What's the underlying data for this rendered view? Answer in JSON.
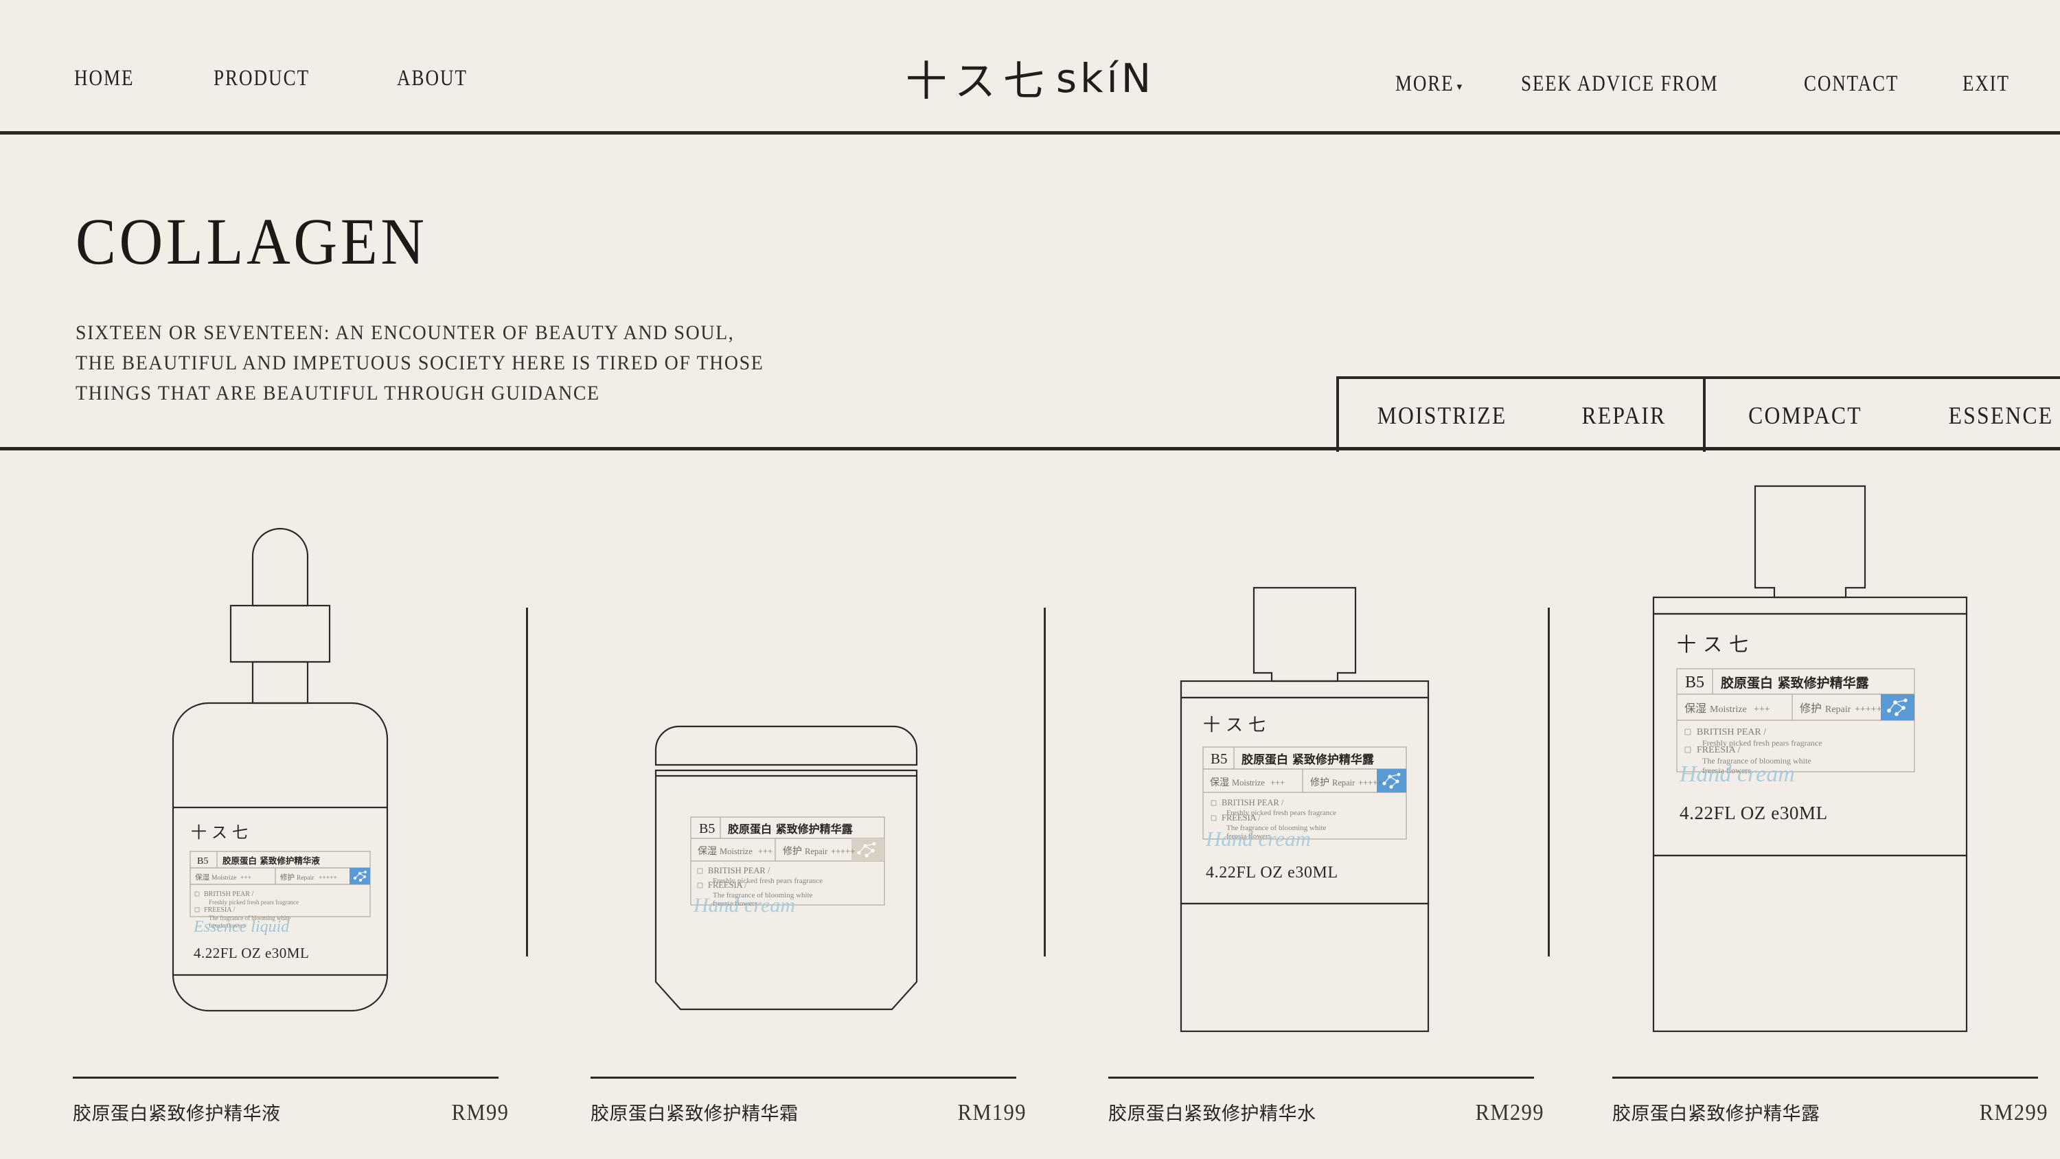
{
  "theme": {
    "background": "#f2ede7",
    "ink": "#2b2622",
    "accent_blue": "#5b9bd5",
    "accent_beige": "#d8d0c4",
    "script_blue": "#9ec9dd"
  },
  "header": {
    "nav_left": [
      {
        "label": "HOME"
      },
      {
        "label": "PRODUCT"
      },
      {
        "label": "ABOUT"
      }
    ],
    "logo": {
      "cjk": "十ス七",
      "latin": "skíN"
    },
    "nav_right": [
      {
        "label": "MORE",
        "caret": "▾"
      },
      {
        "label": "SEEK ADVICE FROM"
      },
      {
        "label": "CONTACT"
      },
      {
        "label": "EXIT"
      }
    ]
  },
  "hero": {
    "title": "COLLAGEN",
    "subtitle_line1": "SIXTEEN OR SEVENTEEN: AN ENCOUNTER OF BEAUTY AND SOUL,",
    "subtitle_line2": "THE BEAUTIFUL AND IMPETUOUS SOCIETY HERE IS TIRED OF THOSE",
    "subtitle_line3": "THINGS THAT ARE BEAUTIFUL THROUGH GUIDANCE"
  },
  "tabs": [
    {
      "label": "MOISTRIZE",
      "boxed": true
    },
    {
      "label": "REPAIR",
      "boxed": true
    },
    {
      "label": "COMPACT",
      "boxed": false
    },
    {
      "label": "ESSENCE",
      "boxed": false
    }
  ],
  "label_common": {
    "brand": "十ス七",
    "badge": "B5",
    "moistrize_cn": "保湿",
    "moistrize_en": "Moistrize",
    "moistrize_rating": "+++",
    "repair_cn": "修护",
    "repair_en": "Repair",
    "repair_rating": "+++++",
    "note1_title": "BRITISH PEAR  /",
    "note1_desc": "Freshly picked fresh pears fragrance",
    "note2_title": "FREESIA  /",
    "note2_desc_line1": "The fragrance of blooming white",
    "note2_desc_line2": "freesia flowers",
    "volume": "4.22FL OZ  e30ML",
    "molecule_icon": "molecule-icon"
  },
  "products": [
    {
      "id": "serum-dropper",
      "name": "胶原蛋白紧致修护精华液",
      "price": "RM99",
      "label_title": "胶原蛋白 紧致修护精华液",
      "signature": "Essence liquid",
      "molecule_color": "#5b9bd5",
      "shape": "dropper-bottle"
    },
    {
      "id": "cream-jar",
      "name": "胶原蛋白紧致修护精华霜",
      "price": "RM199",
      "label_title": "胶原蛋白 紧致修护精华露",
      "signature": "Hand cream",
      "molecule_color": "#d8d0c4",
      "shape": "cream-jar"
    },
    {
      "id": "toner-bottle",
      "name": "胶原蛋白紧致修护精华水",
      "price": "RM299",
      "label_title": "胶原蛋白 紧致修护精华露",
      "signature": "Hand cream",
      "molecule_color": "#5b9bd5",
      "shape": "capped-bottle"
    },
    {
      "id": "lotion-bottle",
      "name": "胶原蛋白紧致修护精华露",
      "price": "RM299",
      "label_title": "胶原蛋白 紧致修护精华露",
      "signature": "Hand cream",
      "molecule_color": "#5b9bd5",
      "shape": "tall-capped-bottle"
    }
  ]
}
